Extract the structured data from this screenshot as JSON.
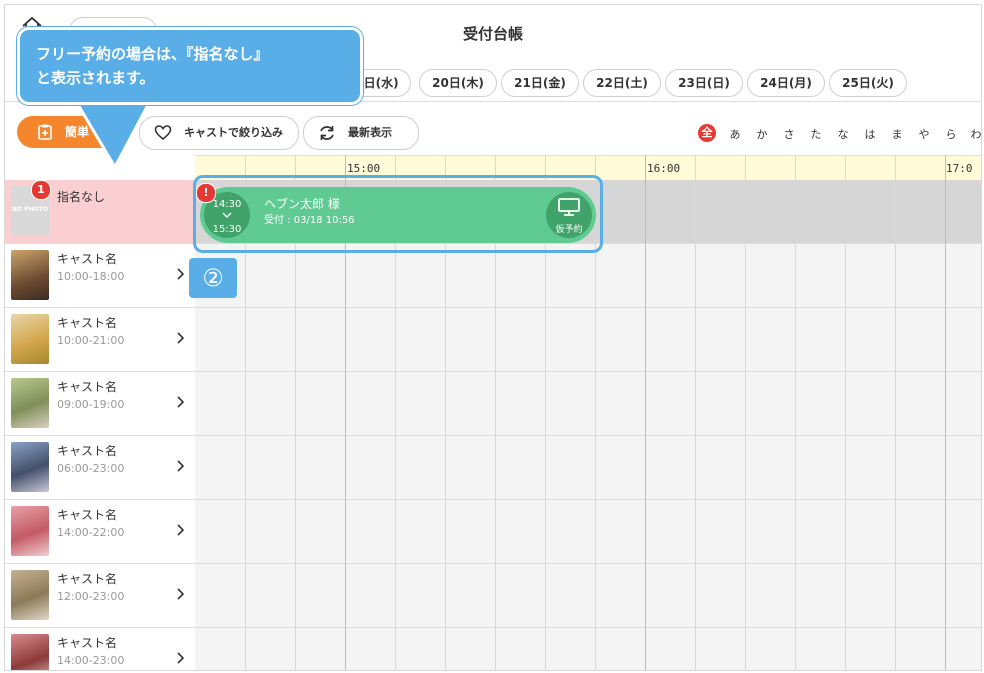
{
  "header": {
    "title": "受付台帳",
    "date_tabs": [
      "0日(水)",
      "20日(木)",
      "21日(金)",
      "22日(土)",
      "23日(日)",
      "24日(月)",
      "25日(火)"
    ]
  },
  "toolbar": {
    "easy_label": "簡単",
    "filter_label": "キャストで絞り込み",
    "refresh_label": "最新表示",
    "kana": [
      "全",
      "あ",
      "か",
      "さ",
      "た",
      "な",
      "は",
      "ま",
      "や",
      "ら",
      "わ"
    ]
  },
  "timeline": {
    "labels": [
      "15:00",
      "16:00",
      "17:0"
    ]
  },
  "free_row": {
    "photo_text": "NO PHOTO",
    "badge": "1",
    "label": "指名なし"
  },
  "casts": [
    {
      "name": "キャスト名",
      "time": "10:00-18:00"
    },
    {
      "name": "キャスト名",
      "time": "10:00-21:00"
    },
    {
      "name": "キャスト名",
      "time": "09:00-19:00"
    },
    {
      "name": "キャスト名",
      "time": "06:00-23:00"
    },
    {
      "name": "キャスト名",
      "time": "14:00-22:00"
    },
    {
      "name": "キャスト名",
      "time": "12:00-23:00"
    },
    {
      "name": "キャスト名",
      "time": "14:00-23:00"
    }
  ],
  "reservation": {
    "alert": "!",
    "start": "14:30",
    "end": "15:30",
    "customer": "ヘブン太郎 様",
    "received": "受付 : 03/18 10:56",
    "status": "仮予約"
  },
  "annotation": {
    "callout_line1": "フリー予約の場合は、『指名なし』",
    "callout_line2": "と表示されます。",
    "step": "②"
  },
  "colors": {
    "accent_orange": "#f5862e",
    "resv_green": "#5fcb92",
    "annotation_blue": "#5aaee8",
    "free_row_pink": "#f9cfd1",
    "alert_red": "#e53935"
  }
}
